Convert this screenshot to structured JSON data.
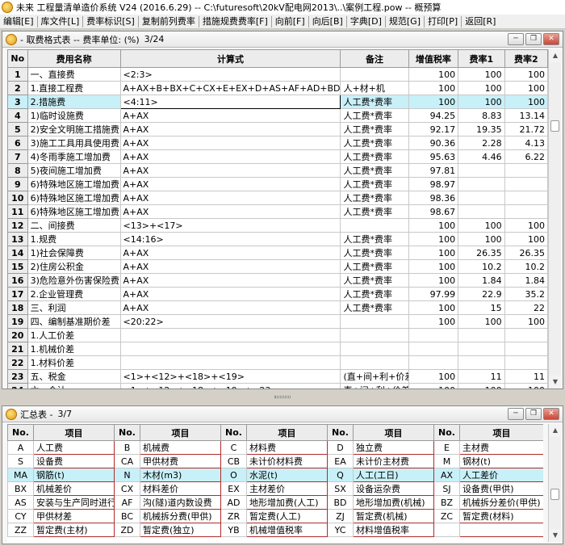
{
  "window": {
    "title": "未来  工程量清单造价系统 V24 (2016.6.29)  -- C:\\futuresoft\\20kV配电网2013\\..\\案例工程.pow  --  概预算"
  },
  "menu": [
    {
      "label": "编辑[E]"
    },
    {
      "label": "库文件[L]"
    },
    {
      "label": "费率标识[S]"
    },
    {
      "label": "复制前列费率"
    },
    {
      "label": "措施规费费率[F]"
    },
    {
      "label": "向前[F]"
    },
    {
      "label": "向后[B]"
    },
    {
      "label": "字典[D]"
    },
    {
      "label": "规范[G]"
    },
    {
      "label": "打印[P]"
    },
    {
      "label": "返回[R]"
    }
  ],
  "top_pane": {
    "title": "- 取费格式表  --  费率单位: (%)",
    "page": "3/24",
    "columns": [
      "No",
      "费用名称",
      "计算式",
      "备注",
      "增值税率",
      "费率1",
      "费率2"
    ],
    "rows": [
      {
        "no": "1",
        "name": "一、直接费",
        "formula": "<2:3>",
        "note": "",
        "vat": "100",
        "r1": "100",
        "r2": "100"
      },
      {
        "no": "2",
        "name": "1.直接工程费",
        "formula": "A+AX+B+BX+C+CX+E+EX+D+AS+AF+AD+BD",
        "note": "人+材+机",
        "vat": "100",
        "r1": "100",
        "r2": "100"
      },
      {
        "no": "3",
        "name": "2.措施费",
        "formula": "<4:11>",
        "note": "人工费*费率",
        "vat": "100",
        "r1": "100",
        "r2": "100"
      },
      {
        "no": "4",
        "name": "1)临时设施费",
        "formula": "A+AX",
        "note": "人工费*费率",
        "vat": "94.25",
        "r1": "8.83",
        "r2": "13.14"
      },
      {
        "no": "5",
        "name": "2)安全文明施工措施费",
        "formula": "A+AX",
        "note": "人工费*费率",
        "vat": "92.17",
        "r1": "19.35",
        "r2": "21.72"
      },
      {
        "no": "6",
        "name": "3)施工工具用具使用费",
        "formula": "A+AX",
        "note": "人工费*费率",
        "vat": "90.36",
        "r1": "2.28",
        "r2": "4.13"
      },
      {
        "no": "7",
        "name": "4)冬雨季施工增加费",
        "formula": "A+AX",
        "note": "人工费*费率",
        "vat": "95.63",
        "r1": "4.46",
        "r2": "6.22"
      },
      {
        "no": "8",
        "name": "5)夜间施工增加费",
        "formula": "A+AX",
        "note": "人工费*费率",
        "vat": "97.81",
        "r1": "",
        "r2": ""
      },
      {
        "no": "9",
        "name": "6)特殊地区施工增加费",
        "formula": "A+AX",
        "note": "人工费*费率",
        "vat": "98.97",
        "r1": "",
        "r2": ""
      },
      {
        "no": "10",
        "name": "6)特殊地区施工增加费",
        "formula": "A+AX",
        "note": "人工费*费率",
        "vat": "98.36",
        "r1": "",
        "r2": ""
      },
      {
        "no": "11",
        "name": "6)特殊地区施工增加费",
        "formula": "A+AX",
        "note": "人工费*费率",
        "vat": "98.67",
        "r1": "",
        "r2": ""
      },
      {
        "no": "12",
        "name": "二、间接费",
        "formula": "<13>+<17>",
        "note": "",
        "vat": "100",
        "r1": "100",
        "r2": "100"
      },
      {
        "no": "13",
        "name": "1.规费",
        "formula": "<14:16>",
        "note": "人工费*费率",
        "vat": "100",
        "r1": "100",
        "r2": "100"
      },
      {
        "no": "14",
        "name": "1)社会保障费",
        "formula": "A+AX",
        "note": "人工费*费率",
        "vat": "100",
        "r1": "26.35",
        "r2": "26.35"
      },
      {
        "no": "15",
        "name": "2)住房公积金",
        "formula": "A+AX",
        "note": "人工费*费率",
        "vat": "100",
        "r1": "10.2",
        "r2": "10.2"
      },
      {
        "no": "16",
        "name": "3)危险意外伤害保险费",
        "formula": "A+AX",
        "note": "人工费*费率",
        "vat": "100",
        "r1": "1.84",
        "r2": "1.84"
      },
      {
        "no": "17",
        "name": "2.企业管理费",
        "formula": "A+AX",
        "note": "人工费*费率",
        "vat": "97.99",
        "r1": "22.9",
        "r2": "35.2"
      },
      {
        "no": "18",
        "name": "三、利润",
        "formula": "A+AX",
        "note": "人工费*费率",
        "vat": "100",
        "r1": "15",
        "r2": "22"
      },
      {
        "no": "19",
        "name": "四、编制基准期价差",
        "formula": "<20:22>",
        "note": "",
        "vat": "100",
        "r1": "100",
        "r2": "100"
      },
      {
        "no": "20",
        "name": "1.人工价差",
        "formula": "",
        "note": "",
        "vat": "",
        "r1": "",
        "r2": ""
      },
      {
        "no": "21",
        "name": "1.机械价差",
        "formula": "",
        "note": "",
        "vat": "",
        "r1": "",
        "r2": ""
      },
      {
        "no": "22",
        "name": "1.材料价差",
        "formula": "",
        "note": "",
        "vat": "",
        "r1": "",
        "r2": ""
      },
      {
        "no": "23",
        "name": "五、税金",
        "formula": "<1>+<12>+<18>+<19>",
        "note": "(直+间+利+价差",
        "vat": "100",
        "r1": "11",
        "r2": "11"
      },
      {
        "no": "24",
        "name": "六、合计",
        "formula": "<1>+<12>+<18>+<19>+<23>",
        "note": "直+间+利+价差",
        "vat": "100",
        "r1": "100",
        "r2": "100"
      }
    ]
  },
  "bottom_pane": {
    "title": "汇总表 -",
    "page": "3/7",
    "columns": [
      "No.",
      "项目",
      "No.",
      "项目",
      "No.",
      "项目",
      "No.",
      "项目",
      "No.",
      "项目"
    ],
    "rows": [
      [
        [
          "A",
          "人工费"
        ],
        [
          "B",
          "机械费"
        ],
        [
          "C",
          "材料费"
        ],
        [
          "D",
          "独立费"
        ],
        [
          "E",
          "主材费"
        ]
      ],
      [
        [
          "S",
          "设备费"
        ],
        [
          "CA",
          "甲供材费"
        ],
        [
          "CB",
          "未计价材料费"
        ],
        [
          "EA",
          "未计价主材费"
        ],
        [
          "M",
          "钢材(t)"
        ]
      ],
      [
        [
          "MA",
          "钢筋(t)"
        ],
        [
          "N",
          "木材(m3)"
        ],
        [
          "O",
          "水泥(t)"
        ],
        [
          "Q",
          "人工(工日)"
        ],
        [
          "AX",
          "人工差价"
        ]
      ],
      [
        [
          "BX",
          "机械差价"
        ],
        [
          "CX",
          "材料差价"
        ],
        [
          "EX",
          "主材差价"
        ],
        [
          "SX",
          "设备运杂费"
        ],
        [
          "SJ",
          "设备费(甲供)"
        ]
      ],
      [
        [
          "AS",
          "安装与生产同时进行增"
        ],
        [
          "AF",
          "沟(隧)道内数设费"
        ],
        [
          "AD",
          "地形增加费(人工)"
        ],
        [
          "BD",
          "地形增加费(机械)"
        ],
        [
          "BZ",
          "机械拆分差价(甲供)"
        ]
      ],
      [
        [
          "CY",
          "甲供材差"
        ],
        [
          "BC",
          "机械拆分费(甲供)"
        ],
        [
          "ZR",
          "暂定费(人工)"
        ],
        [
          "ZJ",
          "暂定费(机械)"
        ],
        [
          "ZC",
          "暂定费(材料)"
        ]
      ],
      [
        [
          "ZZ",
          "暂定费(主材)"
        ],
        [
          "ZD",
          "暂定费(独立)"
        ],
        [
          "YB",
          "机械增值税率"
        ],
        [
          "YC",
          "材料增值税率"
        ],
        [
          "",
          ""
        ]
      ]
    ]
  }
}
